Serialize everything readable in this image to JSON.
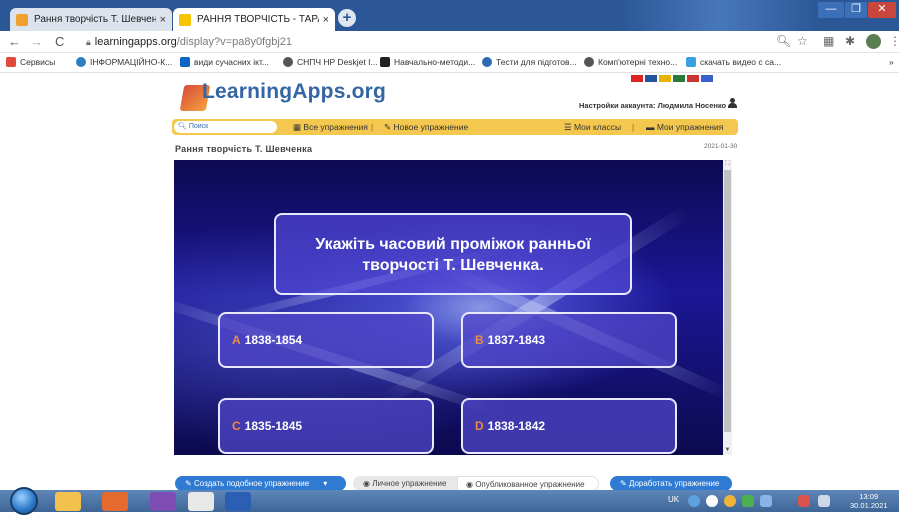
{
  "browser": {
    "tabs": [
      {
        "title": "Рання творчість Т. Шевченка",
        "close": "×"
      },
      {
        "title": "РАННЯ ТВОРЧІСТЬ - ТАРАС ШЕВЧЕНКО",
        "close": "×"
      }
    ],
    "new_tab": "+",
    "window": {
      "minimize": "—",
      "maximize": "❐",
      "close": "✕"
    },
    "address": {
      "domain": "learningapps.org",
      "path": "/display?v=pa8y0fgbj21"
    },
    "nav": {
      "back": "←",
      "forward": "→",
      "reload": "C"
    },
    "toolbar_icons": {
      "zoom": "🔍︎",
      "star": "☆",
      "ext1": "▦",
      "ext2": "✱",
      "menu": "⋮"
    }
  },
  "bookmarks": [
    {
      "label": "Сервисы",
      "color": "#e04a3a"
    },
    {
      "label": "ІНФОРМАЦІЙНО-К...",
      "color": "#2d7fc1"
    },
    {
      "label": "види сучасних ікт...",
      "color": "#0a66c2"
    },
    {
      "label": "СНПЧ HP Deskjet I...",
      "color": "#555555"
    },
    {
      "label": "Навчально-методи...",
      "color": "#222222"
    },
    {
      "label": "Тести для підготов...",
      "color": "#2f6ab5"
    },
    {
      "label": "Комп'ютерні техно...",
      "color": "#555555"
    },
    {
      "label": "скачать видео с са...",
      "color": "#3aa0e6"
    }
  ],
  "bookmarks_more": "»",
  "site": {
    "logo": "LearningApps.org",
    "account": "Настройки аккаунта: Людмила Носенко",
    "search_placeholder": "Поиск",
    "menu": {
      "all": "Все упражнения",
      "new": "Новое упражнение",
      "classes": "Мои классы",
      "mine": "Мои упражнения"
    },
    "page_title": "Рання творчість Т. Шевченка",
    "date": "2021-01-30"
  },
  "exercise": {
    "question": "Укажіть часовий проміжок ранньої творчості Т. Шевченка.",
    "answers": [
      {
        "letter": "A",
        "text": "1838-1854"
      },
      {
        "letter": "B",
        "text": "1837-1843"
      },
      {
        "letter": "C",
        "text": "1835-1845"
      },
      {
        "letter": "D",
        "text": "1838-1842"
      }
    ]
  },
  "buttons": {
    "create": "Создать подобное упражнение",
    "private": "Личное упражнение",
    "public": "Опубликованное упражнение",
    "improve": "Доработать упражнение"
  },
  "taskbar": {
    "lang": "UK",
    "time": "13:09",
    "date": "30.01.2021"
  },
  "colors": {
    "titlebar": "#2b5797",
    "logo": "#3465a4",
    "menubar": "#f4c84f",
    "answer_letter": "#f08a3c",
    "button_blue": "#2f7bd3"
  }
}
